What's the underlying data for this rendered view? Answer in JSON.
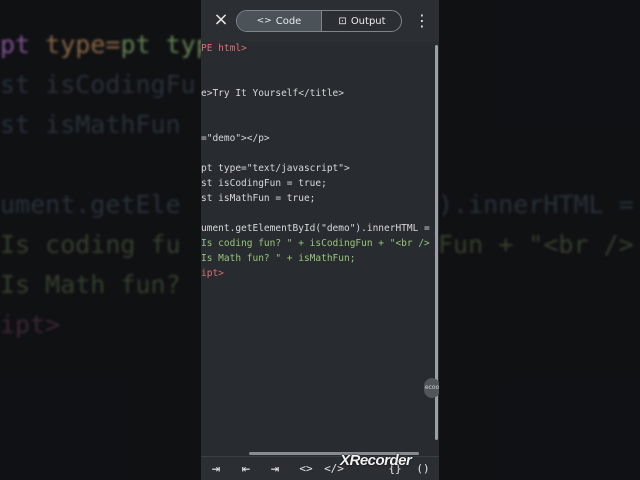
{
  "background_code": {
    "left": [
      "pt type=\"tex",
      "st isCodingFu",
      "st isMathFun",
      "",
      "ument.getEle",
      "Is coding fu",
      "Is Math fun?",
      "ipt>"
    ],
    "right": [
      "",
      "",
      "",
      "",
      ").innerHTML =",
      "Fun + \"<br />",
      "",
      ""
    ]
  },
  "topbar": {
    "close_icon": "×",
    "tab_code": "Code",
    "tab_output": "Output",
    "code_icon": "<>",
    "output_icon": "⊡",
    "menu_icon": "⋮"
  },
  "editor_lines": [
    "PE html>",
    "",
    "",
    "e>Try It Yourself</title>",
    "",
    "",
    "=\"demo\"></p>",
    "",
    "pt type=\"text/javascript\">",
    "st isCodingFun = true;",
    "st isMathFun = true;",
    "",
    "ument.getElementById(\"demo\").innerHTML =",
    "Is coding fun? \" + isCodingFun + \"<br />",
    "Is Math fun? \" + isMathFun;",
    "ipt>"
  ],
  "badge": "ecoo",
  "toolbar": {
    "tab_key": "⇥",
    "left_key": "⇤",
    "right_key": "⇥",
    "tag_key": "<>",
    "close_tag_key": "</>",
    "braces_key": "{}",
    "paren_key": "()"
  },
  "watermark": "XRecorder"
}
